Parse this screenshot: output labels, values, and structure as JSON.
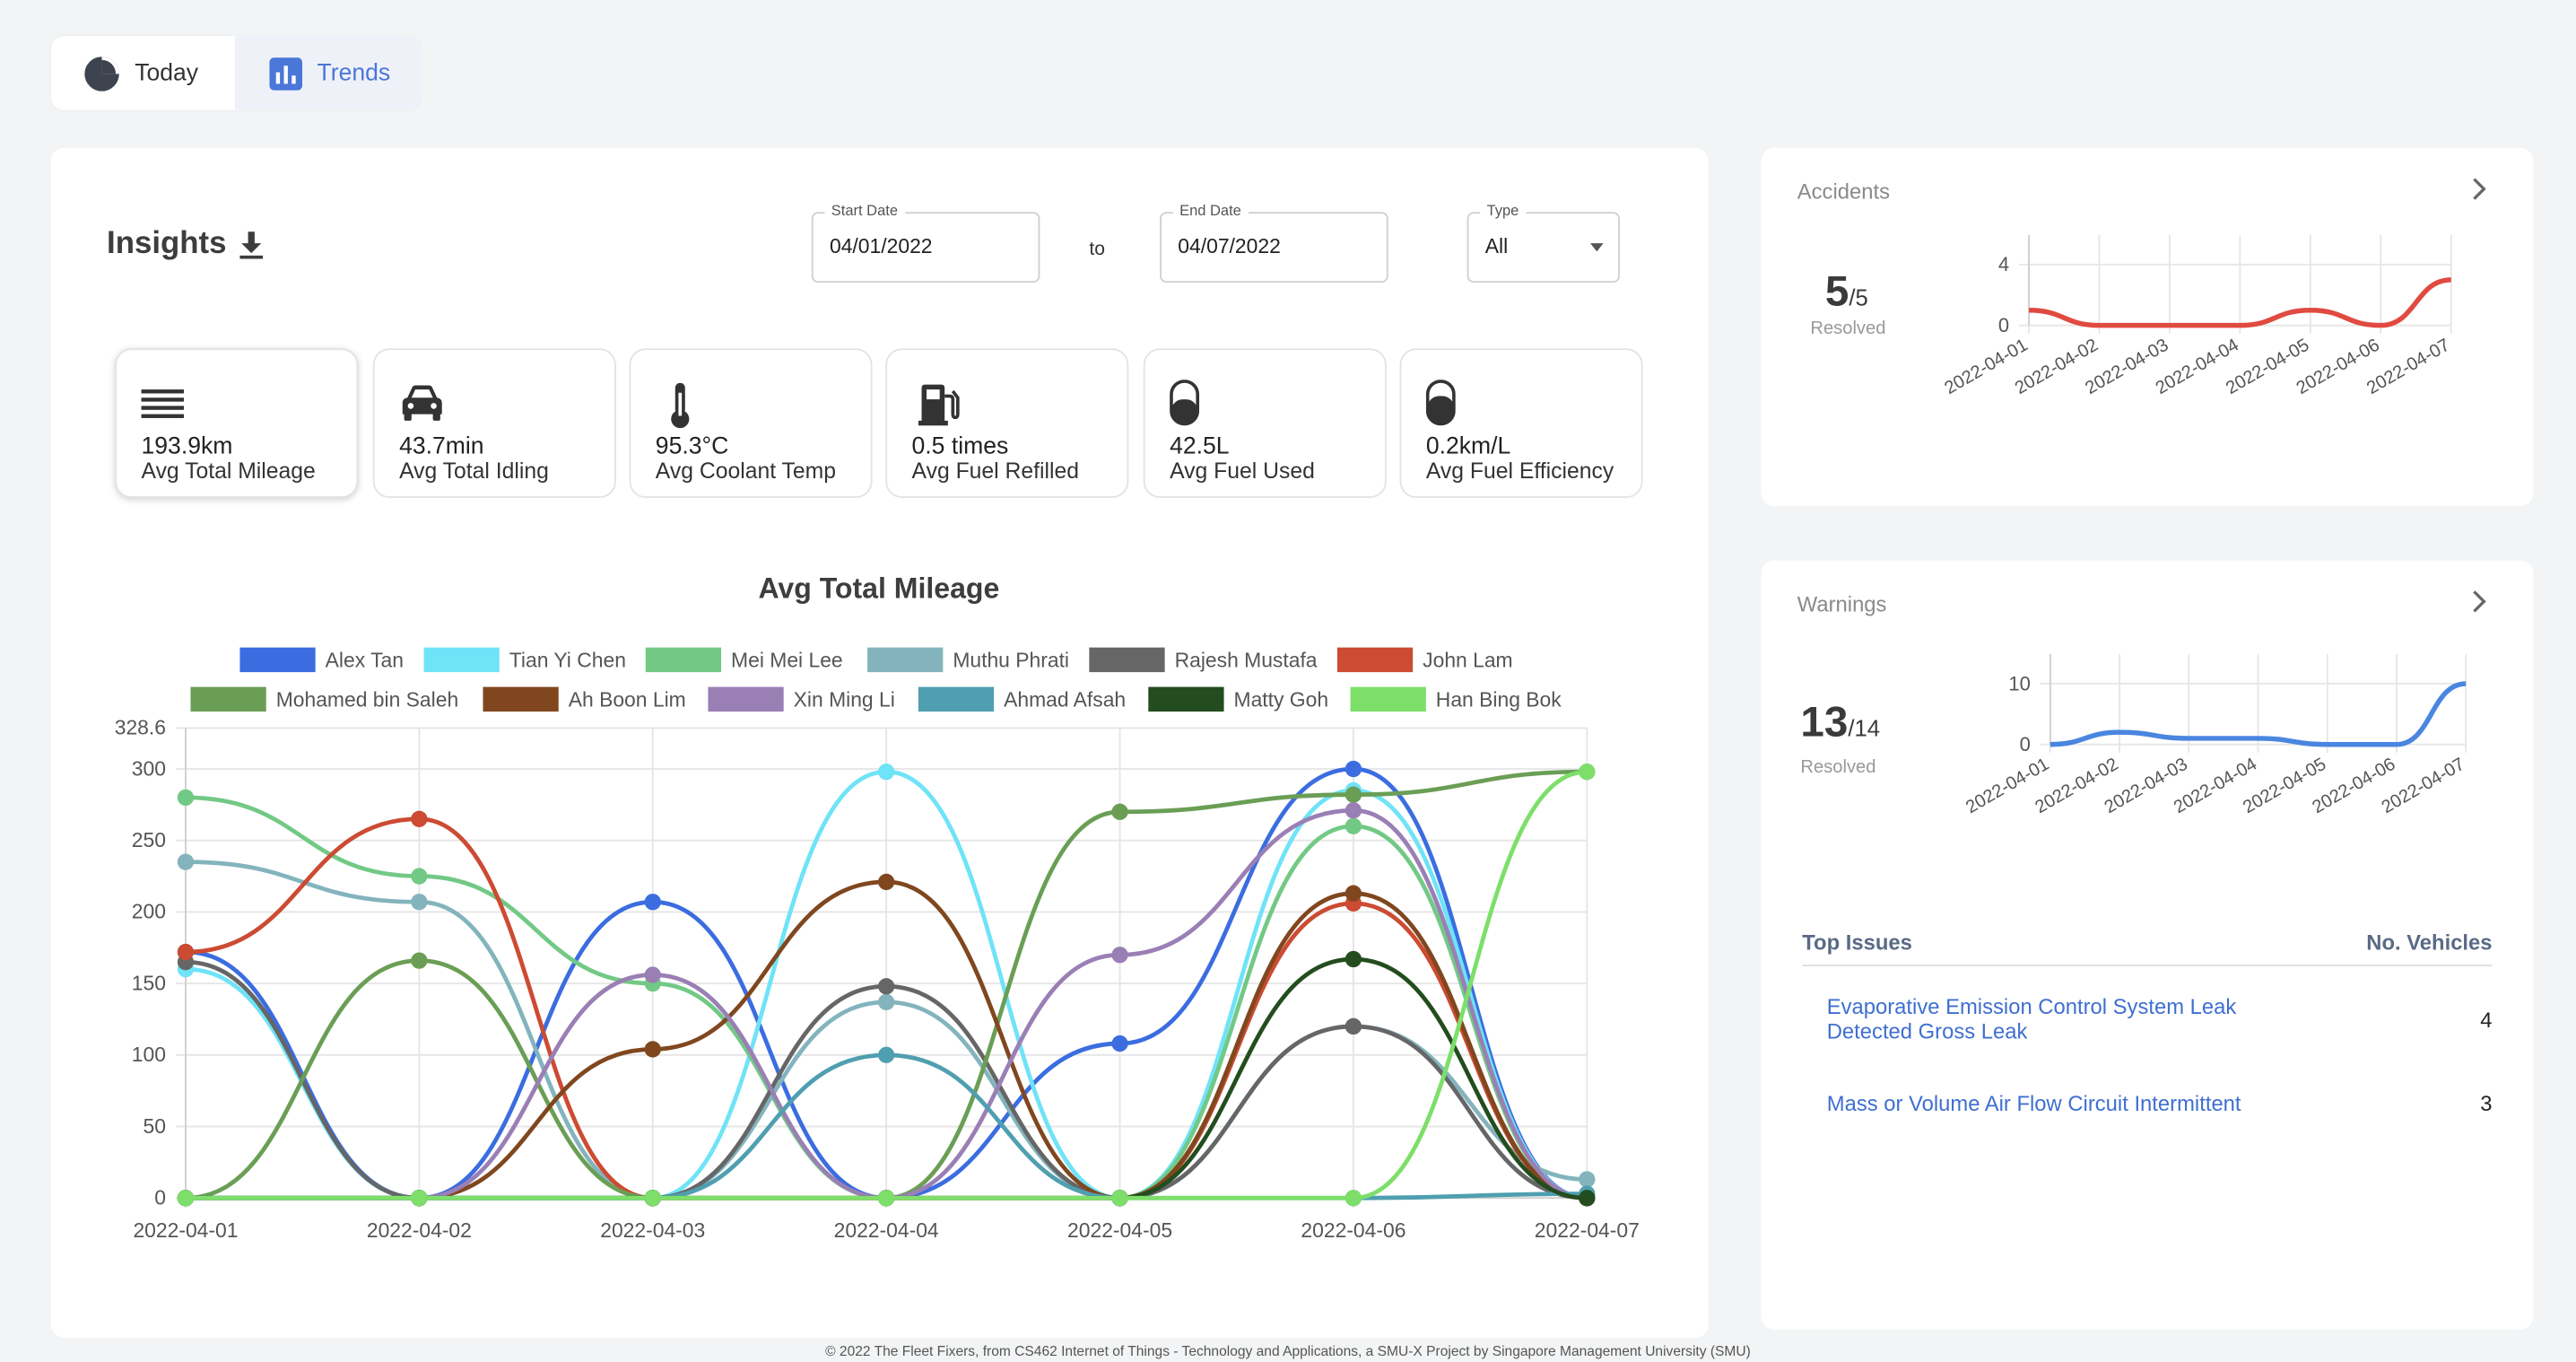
{
  "tabs": [
    {
      "label": "Today",
      "icon": "pie-chart-icon"
    },
    {
      "label": "Trends",
      "icon": "bar-chart-icon",
      "active": true
    }
  ],
  "insights": {
    "title": "Insights",
    "start_date": {
      "label": "Start Date",
      "value": "04/01/2022"
    },
    "to_label": "to",
    "end_date": {
      "label": "End Date",
      "value": "04/07/2022"
    },
    "type": {
      "label": "Type",
      "value": "All"
    }
  },
  "stats": [
    {
      "icon": "list-lines-icon",
      "value": "193.9km",
      "label": "Avg Total Mileage",
      "active": true
    },
    {
      "icon": "car-icon",
      "value": "43.7min",
      "label": "Avg Total Idling"
    },
    {
      "icon": "thermometer-icon",
      "value": "95.3°C",
      "label": "Avg Coolant Temp"
    },
    {
      "icon": "fuel-pump-icon",
      "value": "0.5 times",
      "label": "Avg Fuel Refilled"
    },
    {
      "icon": "fuel-gauge-icon",
      "value": "42.5L",
      "label": "Avg Fuel Used"
    },
    {
      "icon": "fuel-gauge-icon",
      "value": "0.2km/L",
      "label": "Avg Fuel Efficiency"
    }
  ],
  "colors": {
    "accent": "#4a77d8",
    "accident_line": "#e04a40",
    "warning_line": "#4a86e0"
  },
  "accidents": {
    "title": "Accidents",
    "resolved_num": "5",
    "resolved_den": "/5",
    "resolved_label": "Resolved"
  },
  "warnings": {
    "title": "Warnings",
    "resolved_num": "13",
    "resolved_den": "/14",
    "resolved_label": "Resolved"
  },
  "top_issues": {
    "header": "Top Issues",
    "count_header": "No. Vehicles",
    "items": [
      {
        "name": "Evaporative Emission Control System Leak Detected Gross Leak",
        "count": "4"
      },
      {
        "name": "Mass or Volume Air Flow Circuit Intermittent",
        "count": "3"
      }
    ]
  },
  "footer": "© 2022 The Fleet Fixers, from CS462 Internet of Things - Technology and Applications, a SMU-X Project by Singapore Management University (SMU)",
  "chart_data": [
    {
      "type": "line",
      "title": "Avg Total Mileage",
      "x": [
        "2022-04-01",
        "2022-04-02",
        "2022-04-03",
        "2022-04-04",
        "2022-04-05",
        "2022-04-06",
        "2022-04-07"
      ],
      "ylim": [
        0,
        328.6
      ],
      "yticks": [
        "0",
        "50",
        "100",
        "150",
        "200",
        "250",
        "300",
        "328.6"
      ],
      "grid": true,
      "legend": "top",
      "series": [
        {
          "name": "Alex Tan",
          "color": "#3b6de0",
          "values": [
            172,
            0,
            207,
            0,
            108,
            300,
            0
          ]
        },
        {
          "name": "Tian Yi Chen",
          "color": "#6fe3f7",
          "values": [
            160,
            0,
            0,
            298,
            0,
            285,
            0
          ]
        },
        {
          "name": "Mei Mei Lee",
          "color": "#72c985",
          "values": [
            280,
            225,
            150,
            0,
            0,
            260,
            0
          ]
        },
        {
          "name": "Muthu Phrati",
          "color": "#83b4bd",
          "values": [
            235,
            207,
            0,
            137,
            0,
            120,
            13
          ]
        },
        {
          "name": "Rajesh Mustafa",
          "color": "#666666",
          "values": [
            165,
            0,
            0,
            148,
            0,
            120,
            0
          ]
        },
        {
          "name": "John Lam",
          "color": "#cc4b33",
          "values": [
            172,
            265,
            0,
            0,
            0,
            206,
            0
          ]
        },
        {
          "name": "Mohamed bin Saleh",
          "color": "#6a9e55",
          "values": [
            0,
            166,
            0,
            0,
            270,
            282,
            298
          ]
        },
        {
          "name": "Ah Boon Lim",
          "color": "#80471f",
          "values": [
            0,
            0,
            104,
            221,
            0,
            213,
            0
          ]
        },
        {
          "name": "Xin Ming Li",
          "color": "#9a7fb5",
          "values": [
            0,
            0,
            156,
            0,
            170,
            271,
            0
          ]
        },
        {
          "name": "Ahmad Afsah",
          "color": "#4f9fb0",
          "values": [
            0,
            0,
            0,
            100,
            0,
            0,
            3
          ]
        },
        {
          "name": "Matty Goh",
          "color": "#234d1e",
          "values": [
            0,
            0,
            0,
            0,
            0,
            167,
            0
          ]
        },
        {
          "name": "Han Bing Bok",
          "color": "#7ddf6a",
          "values": [
            0,
            0,
            0,
            0,
            0,
            0,
            298
          ]
        }
      ]
    },
    {
      "type": "line",
      "title": "",
      "x": [
        "2022-04-01",
        "2022-04-02",
        "2022-04-03",
        "2022-04-04",
        "2022-04-05",
        "2022-04-06",
        "2022-04-07"
      ],
      "ylim": [
        0,
        4
      ],
      "yticks": [
        "0",
        "4"
      ],
      "series": [
        {
          "values": [
            1,
            0,
            0,
            0,
            1,
            0,
            3
          ]
        }
      ]
    },
    {
      "type": "line",
      "title": "",
      "x": [
        "2022-04-01",
        "2022-04-02",
        "2022-04-03",
        "2022-04-04",
        "2022-04-05",
        "2022-04-06",
        "2022-04-07"
      ],
      "ylim": [
        0,
        10
      ],
      "yticks": [
        "0",
        "10"
      ],
      "series": [
        {
          "values": [
            0,
            2,
            1,
            1,
            0,
            0,
            10
          ]
        }
      ]
    }
  ]
}
